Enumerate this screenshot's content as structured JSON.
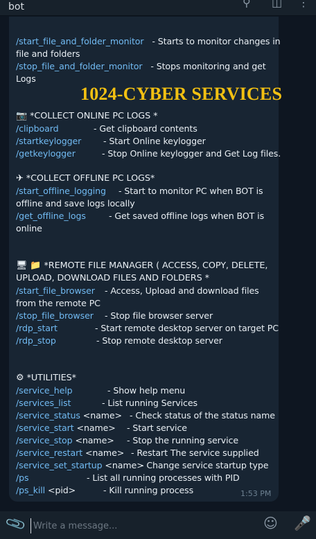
{
  "header": {
    "title": "bot",
    "search_icon": "search-icon",
    "panel_icon": "side-panel-icon",
    "menu_icon": "kebab-menu-icon"
  },
  "watermark": "1024-CYBER SERVICES",
  "sections": {
    "fs": [
      {
        "cmd": "/start_file_and_folder_monitor",
        "desc": "-  Starts to monitor changes in"
      },
      {
        "cont": "file and folders"
      },
      {
        "cmd": "/stop_file_and_folder_monitor",
        "desc": "-  Stops monitoring and get"
      },
      {
        "cont": "Logs"
      }
    ],
    "online_heading": "*COLLECT ONLINE PC LOGS *",
    "online": [
      {
        "cmd": "/clipboard",
        "desc": "- Get clipboard contents"
      },
      {
        "cmd": "/startkeylogger",
        "desc": "- Start Online keylogger"
      },
      {
        "cmd": "/getkeylogger",
        "desc": "- Stop Online keylogger and Get Log files."
      }
    ],
    "offline_heading": "*COLLECT OFFLINE PC LOGS*",
    "offline": [
      {
        "cmd": "/start_offline_logging",
        "desc": "- Start to monitor PC when BOT is"
      },
      {
        "cont": "offline and save logs locally"
      },
      {
        "cmd": "/get_offline_logs",
        "desc": "- Get saved offline logs when BOT is"
      },
      {
        "cont": "online"
      }
    ],
    "remote_heading_1": "*REMOTE FILE MANAGER ( ACCESS, COPY, DELETE,",
    "remote_heading_2": "UPLOAD, DOWNLOAD FILES AND FOLDERS *",
    "remote": [
      {
        "cmd": "/start_file_browser",
        "desc": "-  Access, Upload and download files"
      },
      {
        "cont": "from the remote PC"
      },
      {
        "cmd": "/stop_file_browser",
        "desc": "-  Stop file browser server"
      },
      {
        "cmd": "/rdp_start",
        "desc": "- Start remote desktop server on target PC"
      },
      {
        "cmd": "/rdp_stop",
        "desc": "- Stop remote desktop server"
      }
    ],
    "utilities_heading": "*UTILITIES*",
    "utilities": [
      {
        "cmd": "/service_help",
        "desc": "-  Show help menu"
      },
      {
        "cmd": "/services_list",
        "desc": "-  List running Services"
      },
      {
        "cmd": "/service_status",
        "arg": "<name>",
        "desc": "-  Check status of the status name"
      },
      {
        "cmd": "/service_start",
        "arg": "<name>",
        "desc": "-  Start service"
      },
      {
        "cmd": "/service_stop",
        "arg": "<name>",
        "desc": "-  Stop the running service"
      },
      {
        "cmd": "/service_restart",
        "arg": "<name>",
        "desc": "-  Restart The service supplied"
      },
      {
        "cmd": "/service_set_startup",
        "arg": "<name>",
        "desc": "-  Change service startup type"
      },
      {
        "cmd": "/ps",
        "desc": "-  List all running processes with PID"
      },
      {
        "cmd": "/ps_kill",
        "arg": "<pid>",
        "desc": "-  Kill running process"
      }
    ]
  },
  "message_time": "1:53 PM",
  "composer": {
    "placeholder": "Write a message...",
    "attach_icon": "paperclip-icon",
    "emoji_icon": "emoji-icon",
    "mic_icon": "microphone-icon"
  },
  "colors": {
    "background": "#0e1621",
    "bubble": "#182533",
    "command_link": "#71baf2",
    "watermark": "#f2c012"
  }
}
